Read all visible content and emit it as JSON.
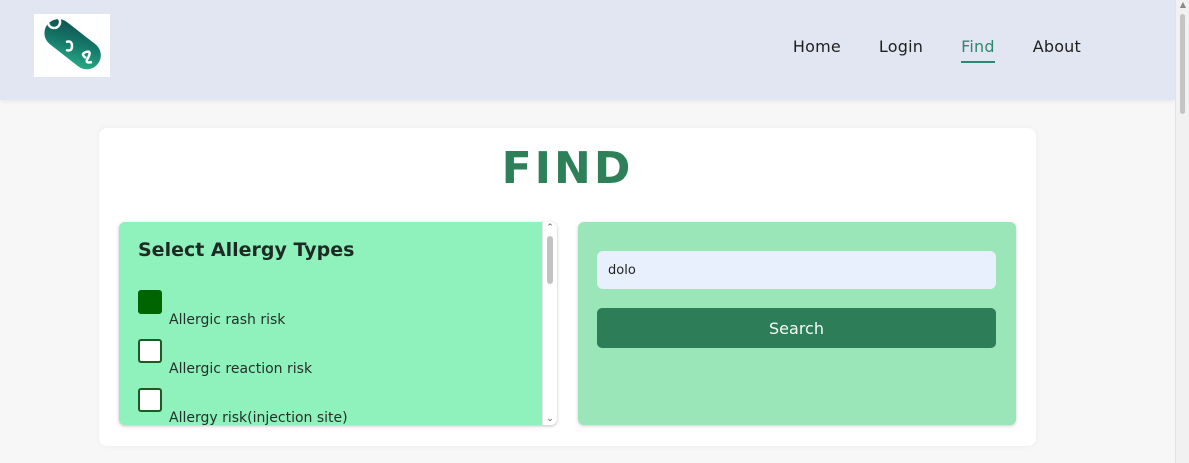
{
  "header": {
    "logo_icon": "pds-capsule-logo",
    "nav": [
      {
        "label": "Home",
        "active": false
      },
      {
        "label": "Login",
        "active": false
      },
      {
        "label": "Find",
        "active": true
      },
      {
        "label": "About",
        "active": false
      }
    ]
  },
  "main": {
    "title": "FIND",
    "allergy": {
      "heading": "Select Allergy Types",
      "options": [
        {
          "label": "Allergic rash risk",
          "checked": true
        },
        {
          "label": "Allergic reaction risk",
          "checked": false
        },
        {
          "label": "Allergy risk(injection site)",
          "checked": false
        }
      ]
    },
    "search": {
      "value": "dolo",
      "button_label": "Search"
    }
  },
  "colors": {
    "header_bg": "#e2e6f2",
    "accent_green": "#2e8058",
    "active_nav": "#2b8a6e",
    "allergy_panel_bg": "#8ff2bc",
    "search_panel_bg": "#9be6b8",
    "checkbox_checked": "#006400",
    "search_button_bg": "#2d7d58",
    "input_bg": "#e8f0fe"
  }
}
